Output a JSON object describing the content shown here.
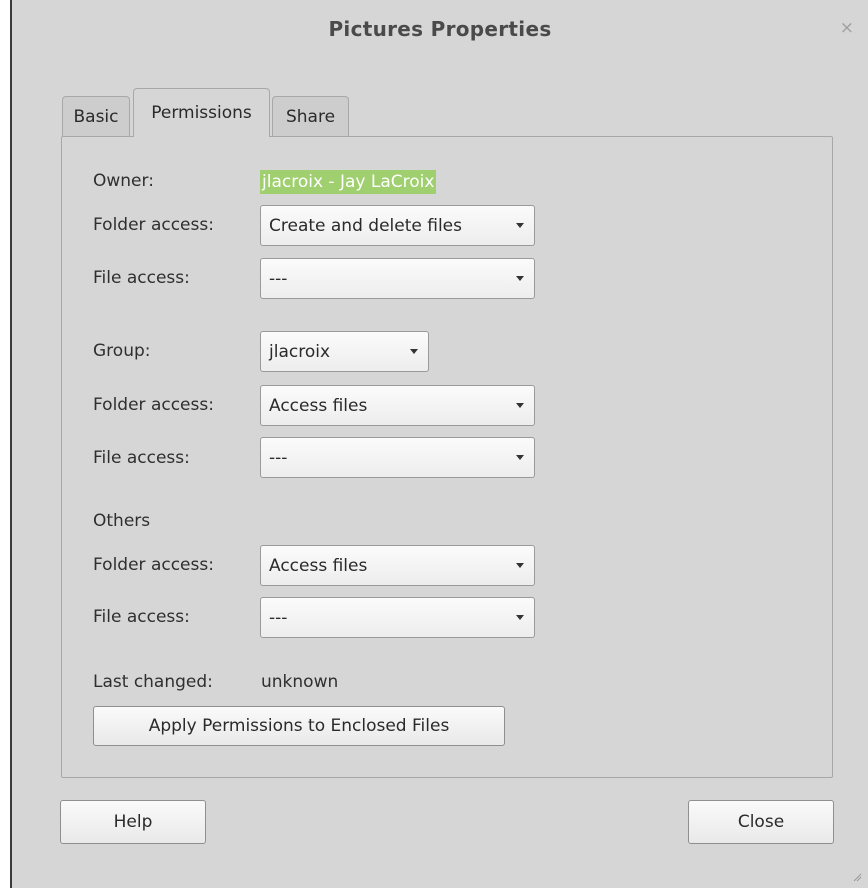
{
  "window": {
    "title": "Pictures Properties",
    "close_glyph": "×"
  },
  "tabs": [
    {
      "label": "Basic",
      "active": false
    },
    {
      "label": "Permissions",
      "active": true
    },
    {
      "label": "Share",
      "active": false
    }
  ],
  "owner": {
    "label": "Owner:",
    "value": "jlacroix - Jay LaCroix",
    "folder_access_label": "Folder access:",
    "folder_access_value": "Create and delete files",
    "file_access_label": "File access:",
    "file_access_value": "---"
  },
  "group": {
    "label": "Group:",
    "value": "jlacroix",
    "folder_access_label": "Folder access:",
    "folder_access_value": "Access files",
    "file_access_label": "File access:",
    "file_access_value": "---"
  },
  "others": {
    "label": "Others",
    "folder_access_label": "Folder access:",
    "folder_access_value": "Access files",
    "file_access_label": "File access:",
    "file_access_value": "---"
  },
  "last_changed": {
    "label": "Last changed:",
    "value": "unknown"
  },
  "apply_button": "Apply Permissions to Enclosed Files",
  "footer": {
    "help_label": "Help",
    "close_label": "Close"
  },
  "colors": {
    "selection_highlight": "#9fcf6f",
    "window_bg": "#d6d6d6"
  },
  "icons": {
    "dropdown": "chevron-down-icon",
    "close": "close-icon",
    "resize": "resize-grip-icon"
  }
}
